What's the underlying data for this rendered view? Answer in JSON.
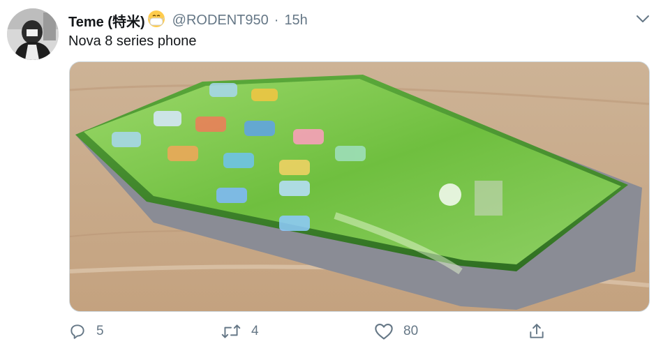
{
  "tweet": {
    "author_name": "Teme (特米)",
    "author_emoji": "mask-face-emoji",
    "handle": "@RODENT950",
    "separator": "·",
    "time": "15h",
    "text": "Nova 8 series phone",
    "media": {
      "description_icon": "photo-of-phone",
      "alt": ""
    }
  },
  "actions": {
    "reply_count": "5",
    "retweet_count": "4",
    "like_count": "80"
  },
  "icons": {
    "caret": "chevron-down-icon",
    "reply": "reply-icon",
    "retweet": "retweet-icon",
    "like": "heart-icon",
    "share": "share-icon"
  },
  "colors": {
    "text_primary": "#14171a",
    "text_secondary": "#657786",
    "border": "#ccd6dd",
    "screen_green": "#7ccd4e"
  }
}
